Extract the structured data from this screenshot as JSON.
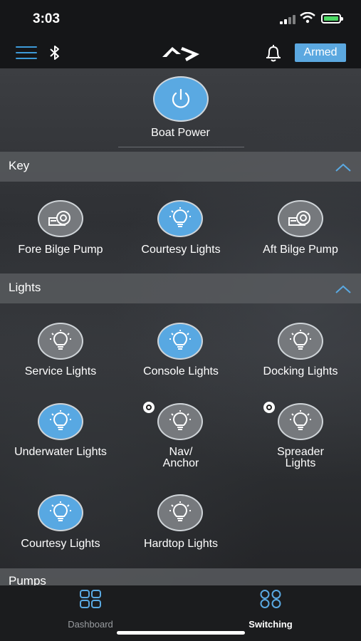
{
  "status_bar": {
    "time": "3:03"
  },
  "header": {
    "armed_label": "Armed",
    "icons": [
      "menu-icon",
      "bluetooth-icon",
      "brand-logo",
      "bell-icon"
    ]
  },
  "power": {
    "label": "Boat Power",
    "state": "on"
  },
  "sections": {
    "key": {
      "title": "Key"
    },
    "lights": {
      "title": "Lights"
    },
    "pumps": {
      "title": "Pumps"
    }
  },
  "key_items": [
    {
      "label": "Fore Bilge Pump",
      "icon": "pump-icon",
      "on": false
    },
    {
      "label": "Courtesy Lights",
      "icon": "bulb-icon",
      "on": true
    },
    {
      "label": "Aft Bilge Pump",
      "icon": "pump-icon",
      "on": false
    }
  ],
  "light_items": [
    {
      "label": "Service Lights",
      "on": false
    },
    {
      "label": "Console Lights",
      "on": true
    },
    {
      "label": "Docking Lights",
      "on": false
    },
    {
      "label": "Underwater Lights",
      "on": true
    },
    {
      "label_line1": "Nav/",
      "label_line2": "Anchor",
      "on": false
    },
    {
      "label_line1": "Spreader",
      "label_line2": "Lights",
      "on": false
    },
    {
      "label": "Courtesy Lights",
      "on": true
    },
    {
      "label": "Hardtop Lights",
      "on": false
    }
  ],
  "tabs": [
    {
      "label": "Dashboard",
      "active": false
    },
    {
      "label": "Switching",
      "active": true
    }
  ],
  "colors": {
    "accent": "#58a8e2",
    "inactive": "#76797d",
    "armed_bg": "#5ba8e0"
  }
}
